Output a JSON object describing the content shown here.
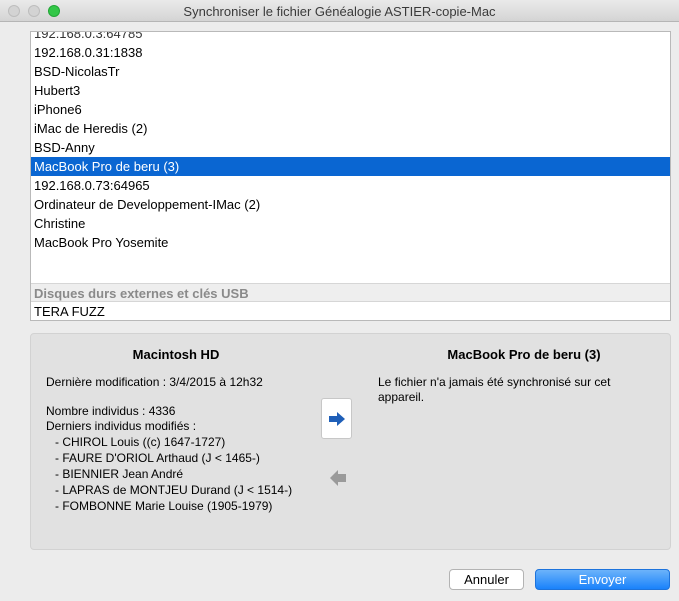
{
  "window": {
    "title": "Synchroniser le fichier Généalogie ASTIER-copie-Mac"
  },
  "device_list": {
    "partial_top_row": "192.168.0.3:64785",
    "items": [
      "192.168.0.31:1838",
      "BSD-NicolasTr",
      "Hubert3",
      "iPhone6",
      "iMac de Heredis (2)",
      "BSD-Anny",
      "MacBook Pro de beru (3)",
      "192.168.0.73:64965",
      "Ordinateur de Developpement-IMac (2)",
      "Christine",
      "MacBook Pro Yosemite"
    ],
    "selected_index": 6,
    "usb_section_label": "Disques durs externes et clés USB",
    "usb_items": [
      "TERA FUZZ"
    ]
  },
  "source": {
    "title": "Macintosh HD",
    "last_modified": "Dernière modification : 3/4/2015 à 12h32",
    "count": "Nombre individus : 4336",
    "recent_label": "Derniers individus modifiés :",
    "recent": [
      "- CHIROL Louis ((c) 1647-1727)",
      "- FAURE D'ORIOL Arthaud (J < 1465-)",
      "- BIENNIER Jean André",
      "- LAPRAS de MONTJEU Durand (J < 1514-)",
      "- FOMBONNE Marie Louise (1905-1979)"
    ]
  },
  "destination": {
    "title": "MacBook Pro de beru (3)",
    "status_line1": "Le fichier n'a jamais été synchronisé sur cet",
    "status_line2": "appareil."
  },
  "buttons": {
    "cancel": "Annuler",
    "send": "Envoyer"
  },
  "colors": {
    "selection": "#0a66d2",
    "send_button": "#1a82fb",
    "arrow_active": "#1f5fb8",
    "arrow_inactive": "#9a9a9a"
  }
}
